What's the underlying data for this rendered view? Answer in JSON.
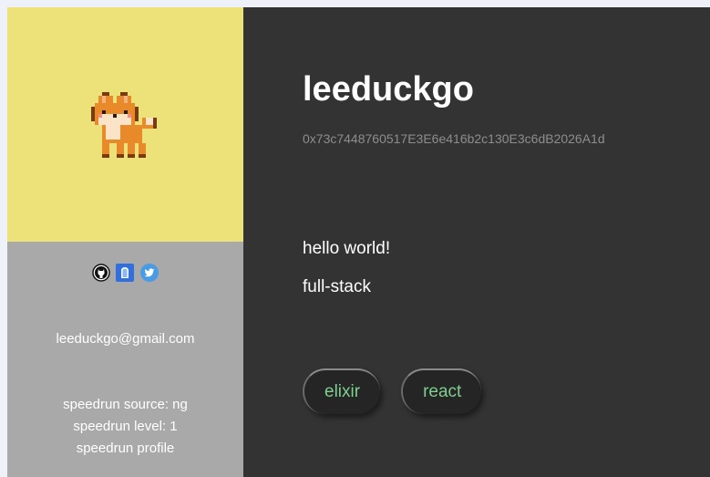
{
  "profile": {
    "username": "leeduckgo",
    "address": "0x73c7448760517E3E6e416b2c130E3c6dB2026A1d",
    "bio_lines": [
      "hello world!",
      "full-stack"
    ],
    "tags": [
      "elixir",
      "react"
    ],
    "email": "leeduckgo@gmail.com",
    "speedrun": {
      "source": "speedrun source: ng",
      "level": "speedrun level: 1",
      "profile": "speedrun profile"
    }
  },
  "socials": [
    {
      "icon": "github-icon"
    },
    {
      "icon": "mirror-icon"
    },
    {
      "icon": "twitter-icon"
    }
  ],
  "colors": {
    "avatar_bg": "#ede27a",
    "info_bg": "#a9a9a9",
    "main_bg": "#333333",
    "tag_text": "#7fcf8f",
    "address_text": "#8d8d8d"
  }
}
